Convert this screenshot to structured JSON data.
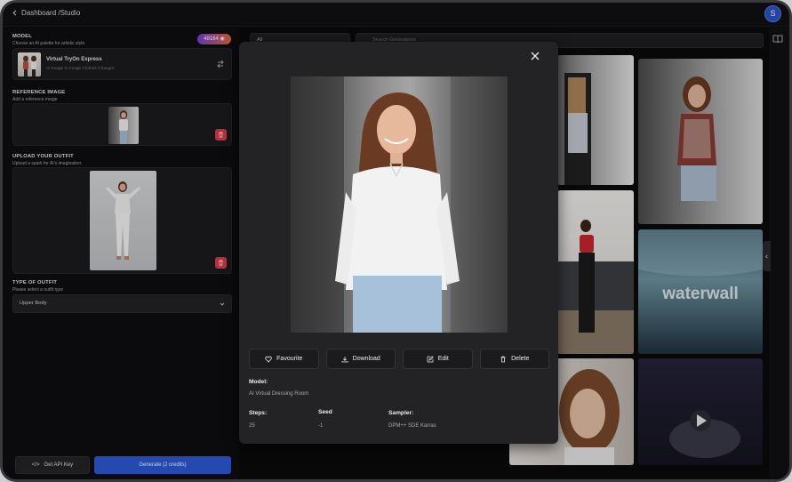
{
  "header": {
    "breadcrumb": "Dashboard /Studio",
    "avatar_initial": "S"
  },
  "model": {
    "title": "MODEL",
    "subtitle": "Choose an AI palette for artistic style.",
    "credits": "48164",
    "name": "Virtual TryOn Express",
    "description": "AI Image to Image Clothes Changer"
  },
  "reference": {
    "title": "REFERENCE IMAGE",
    "subtitle": "Add a reference image"
  },
  "outfit_upload": {
    "title": "UPLOAD YOUR OUTFIT",
    "subtitle": "Upload a spark for AI's imagination."
  },
  "outfit_type": {
    "title": "TYPE OF OUTFIT",
    "subtitle": "Please select a outfit type",
    "selected": "Upper Body"
  },
  "buttons": {
    "api_key": "Get API Key",
    "generate": "Generate (2 credits)"
  },
  "gallery": {
    "filter_selected": "All",
    "search_placeholder": "Search Generations",
    "waterwall_text": "waterwall"
  },
  "modal": {
    "actions": [
      {
        "label": "Favourite",
        "icon": "heart-icon"
      },
      {
        "label": "Download",
        "icon": "download-icon"
      },
      {
        "label": "Edit",
        "icon": "edit-icon"
      },
      {
        "label": "Delete",
        "icon": "trash-icon"
      }
    ],
    "model_label": "Model:",
    "model_value": "AI Virtual Dressing Room",
    "steps_label": "Steps:",
    "steps_value": "25",
    "seed_label": "Seed",
    "seed_value": "-1",
    "sampler_label": "Sampler:",
    "sampler_value": "DPM++ SDE Karras"
  },
  "colors": {
    "accent_blue": "#2c5ad8",
    "delete_red": "#e03b4a",
    "panel_bg": "#232325"
  }
}
